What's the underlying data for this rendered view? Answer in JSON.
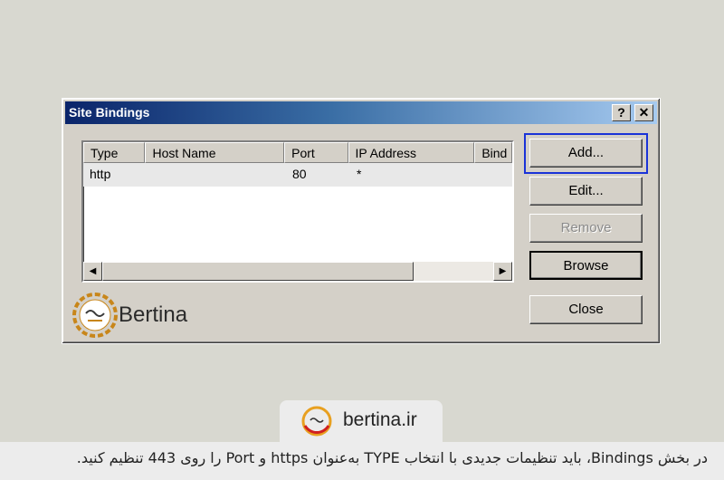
{
  "dialog": {
    "title": "Site Bindings",
    "help_label": "?",
    "close_label": "✕"
  },
  "listview": {
    "columns": [
      "Type",
      "Host Name",
      "Port",
      "IP Address",
      "Bind"
    ],
    "rows": [
      {
        "type": "http",
        "host_name": "",
        "port": "80",
        "ip_address": "*"
      }
    ],
    "scroll_left": "◀",
    "scroll_right": "▶"
  },
  "buttons": {
    "add": "Add...",
    "edit": "Edit...",
    "remove": "Remove",
    "browse": "Browse",
    "close": "Close"
  },
  "branding": {
    "watermark_text": "Bertina",
    "site": "bertina.ir"
  },
  "caption": "در بخش Bindings، باید تنظیمات جدیدی با انتخاب TYPE به‌عنوان https و Port را روی 443 تنظیم کنید.",
  "colors": {
    "titlebar_start": "#0a246a",
    "focus_ring": "#1a33d8",
    "logo_accent": "#c8861a"
  }
}
